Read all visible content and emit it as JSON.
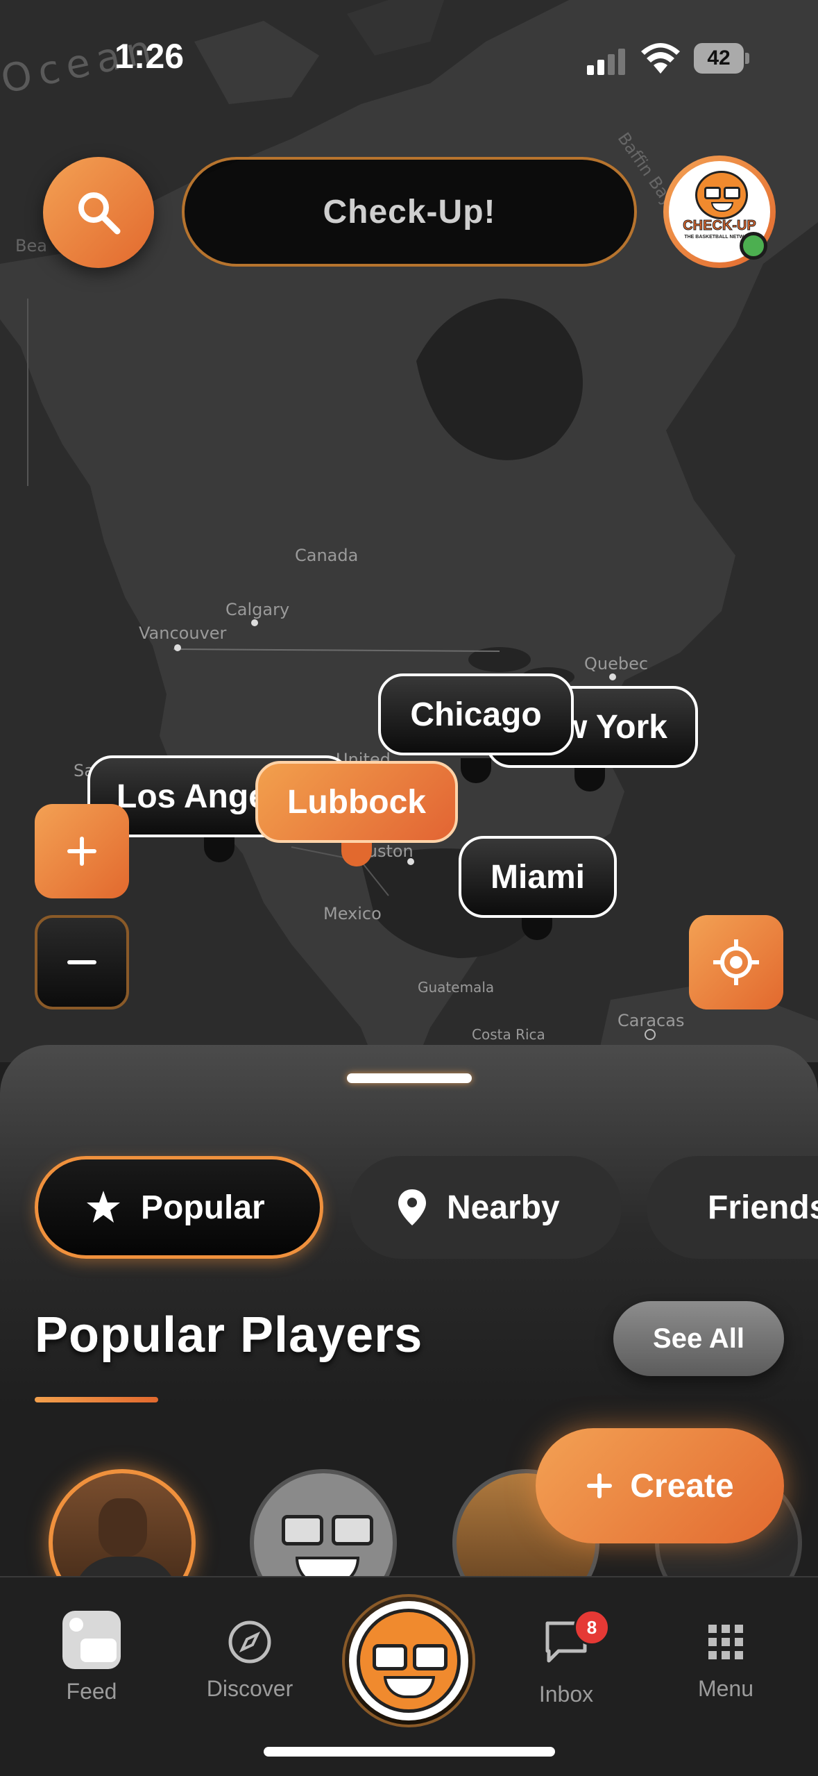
{
  "status_bar": {
    "time": "1:26",
    "battery": "42"
  },
  "header": {
    "title": "Check-Up!",
    "avatar_logo": "CHECK-UP",
    "avatar_tagline": "THE BASKETBALL NETWORK"
  },
  "map": {
    "labels": {
      "ocean": "Ocean",
      "canada": "Canada",
      "calgary": "Calgary",
      "vancouver": "Vancouver",
      "quebec": "Quebec",
      "houston": "Houston",
      "mexico": "Mexico",
      "guatemala": "Guatemala",
      "costa_rica": "Costa Rica",
      "caracas": "Caracas",
      "united": "United",
      "beau": "Bea",
      "baffin": "Baffin Bay",
      "sa": "Sa"
    },
    "cities": [
      {
        "name": "Los Angeles",
        "active": false
      },
      {
        "name": "Lubbock",
        "active": true
      },
      {
        "name": "Chicago",
        "active": false
      },
      {
        "name": "New York",
        "active": false
      },
      {
        "name": "Miami",
        "active": false
      }
    ],
    "zoom_in": "+",
    "zoom_out": "−"
  },
  "filters": [
    {
      "label": "Popular",
      "icon": "star-icon",
      "active": true
    },
    {
      "label": "Nearby",
      "icon": "location-pin-icon",
      "active": false
    },
    {
      "label": "Friends",
      "icon": "people-icon",
      "active": false
    }
  ],
  "section": {
    "title": "Popular Players",
    "see_all": "See All"
  },
  "create_button": {
    "label": "Create"
  },
  "nav": {
    "items": [
      {
        "label": "Feed"
      },
      {
        "label": "Discover"
      },
      {
        "label": ""
      },
      {
        "label": "Inbox",
        "badge": "8"
      },
      {
        "label": "Menu"
      }
    ]
  },
  "colors": {
    "accent": "#F0913D",
    "accent_dark": "#E2692E",
    "background": "#1F1F1F",
    "online": "#4CAF50",
    "badge": "#E53935"
  }
}
